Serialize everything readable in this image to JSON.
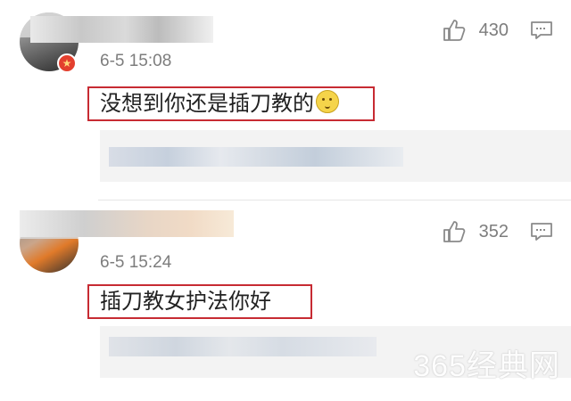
{
  "comments": [
    {
      "time": "6-5 15:08",
      "likes": "430",
      "text": "没想到你还是插刀教的",
      "emoji_icon": "smiling-face-emoji",
      "badge_icon": "verified-star-icon"
    },
    {
      "time": "6-5 15:24",
      "likes": "352",
      "text": "插刀教女护法你好"
    }
  ],
  "watermark": "365经典网",
  "colors": {
    "highlight_border": "#c72b33",
    "secondary_text": "#7d7d7d",
    "reply_bg": "#f3f3f3"
  }
}
